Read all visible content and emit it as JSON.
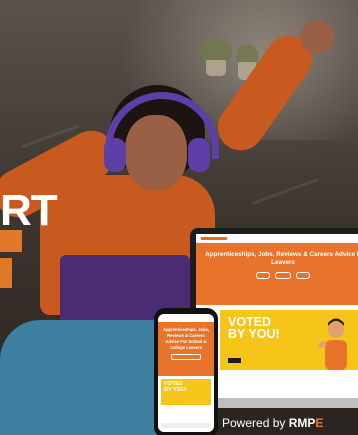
{
  "hero_text_fragment": "RT",
  "laptop_site": {
    "headline_line1": "Apprenticeships, Jobs, Reviews & Careers Advice F",
    "headline_line2": "Leavers",
    "voted_line1": "VOTED",
    "voted_line2": "BY YOU!"
  },
  "phone_site": {
    "headline": "Apprenticeships, Jobs, Reviews & Careers Advice For School & College Leavers",
    "voted_line1": "VOTED",
    "voted_line2": "BY YOU!"
  },
  "footer": {
    "powered_prefix": "Powered by ",
    "brand": "RMP",
    "brand_tail": "E"
  },
  "colors": {
    "brand_orange": "#e8732a",
    "voted_yellow": "#f5c51a",
    "sweater_orange": "#c85a1f",
    "headphones_purple": "#5e3fa8"
  }
}
